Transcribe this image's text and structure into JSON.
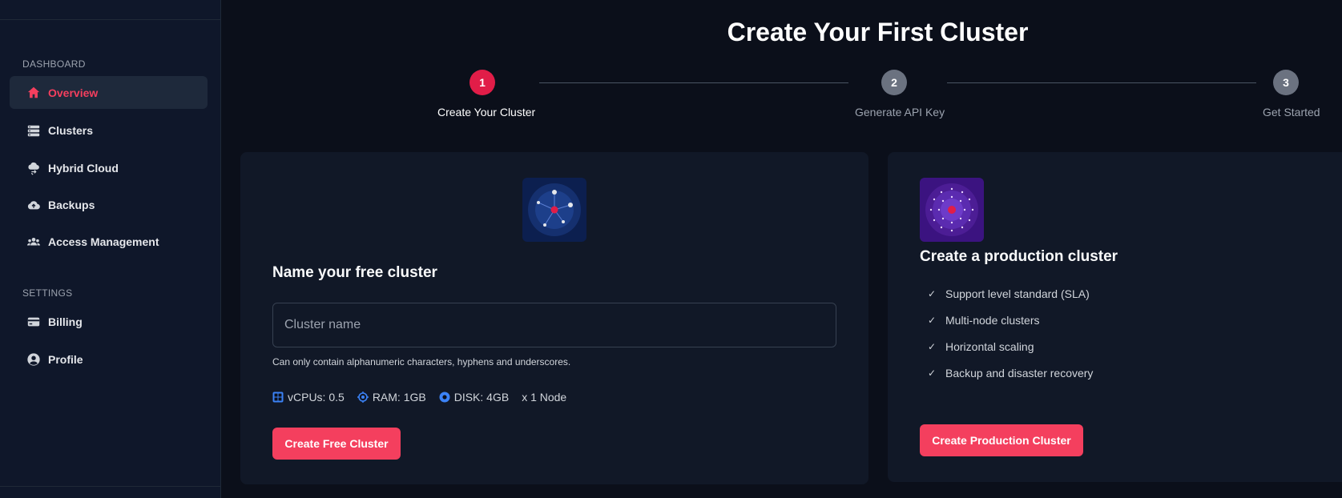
{
  "sidebar": {
    "sections": [
      {
        "label": "DASHBOARD"
      },
      {
        "label": "SETTINGS"
      }
    ],
    "items": [
      {
        "label": "Overview",
        "icon": "home-icon",
        "active": true
      },
      {
        "label": "Clusters",
        "icon": "server-stack-icon"
      },
      {
        "label": "Hybrid Cloud",
        "icon": "cloud-sync-icon"
      },
      {
        "label": "Backups",
        "icon": "cloud-upload-icon"
      },
      {
        "label": "Access Management",
        "icon": "users-icon"
      },
      {
        "label": "Billing",
        "icon": "credit-card-icon"
      },
      {
        "label": "Profile",
        "icon": "user-circle-icon"
      }
    ]
  },
  "page": {
    "title": "Create Your First Cluster"
  },
  "stepper": {
    "steps": [
      {
        "number": "1",
        "label": "Create Your Cluster",
        "state": "active"
      },
      {
        "number": "2",
        "label": "Generate API Key",
        "state": "inactive"
      },
      {
        "number": "3",
        "label": "Get Started",
        "state": "inactive"
      }
    ]
  },
  "free_card": {
    "heading": "Name your free cluster",
    "input_placeholder": "Cluster name",
    "input_value": "",
    "hint": "Can only contain alphanumeric characters, hyphens and underscores.",
    "specs": [
      {
        "icon": "cpu-grid-icon",
        "label": "vCPUs: 0.5"
      },
      {
        "icon": "memory-chip-icon",
        "label": "RAM: 1GB"
      },
      {
        "icon": "disk-icon",
        "label": "DISK: 4GB"
      }
    ],
    "node_count": "x 1 Node",
    "button_label": "Create Free Cluster"
  },
  "prod_card": {
    "heading": "Create a production cluster",
    "features": [
      "Support level standard (SLA)",
      "Multi-node clusters",
      "Horizontal scaling",
      "Backup and disaster recovery"
    ],
    "button_label": "Create Production Cluster"
  },
  "colors": {
    "accent": "#f43f5e",
    "active_step": "#e11d48",
    "inactive_step": "#6b7280",
    "spec_icon": "#3b82f6",
    "background": "#0b0f1a",
    "sidebar": "#0f172a",
    "card": "#111827"
  }
}
